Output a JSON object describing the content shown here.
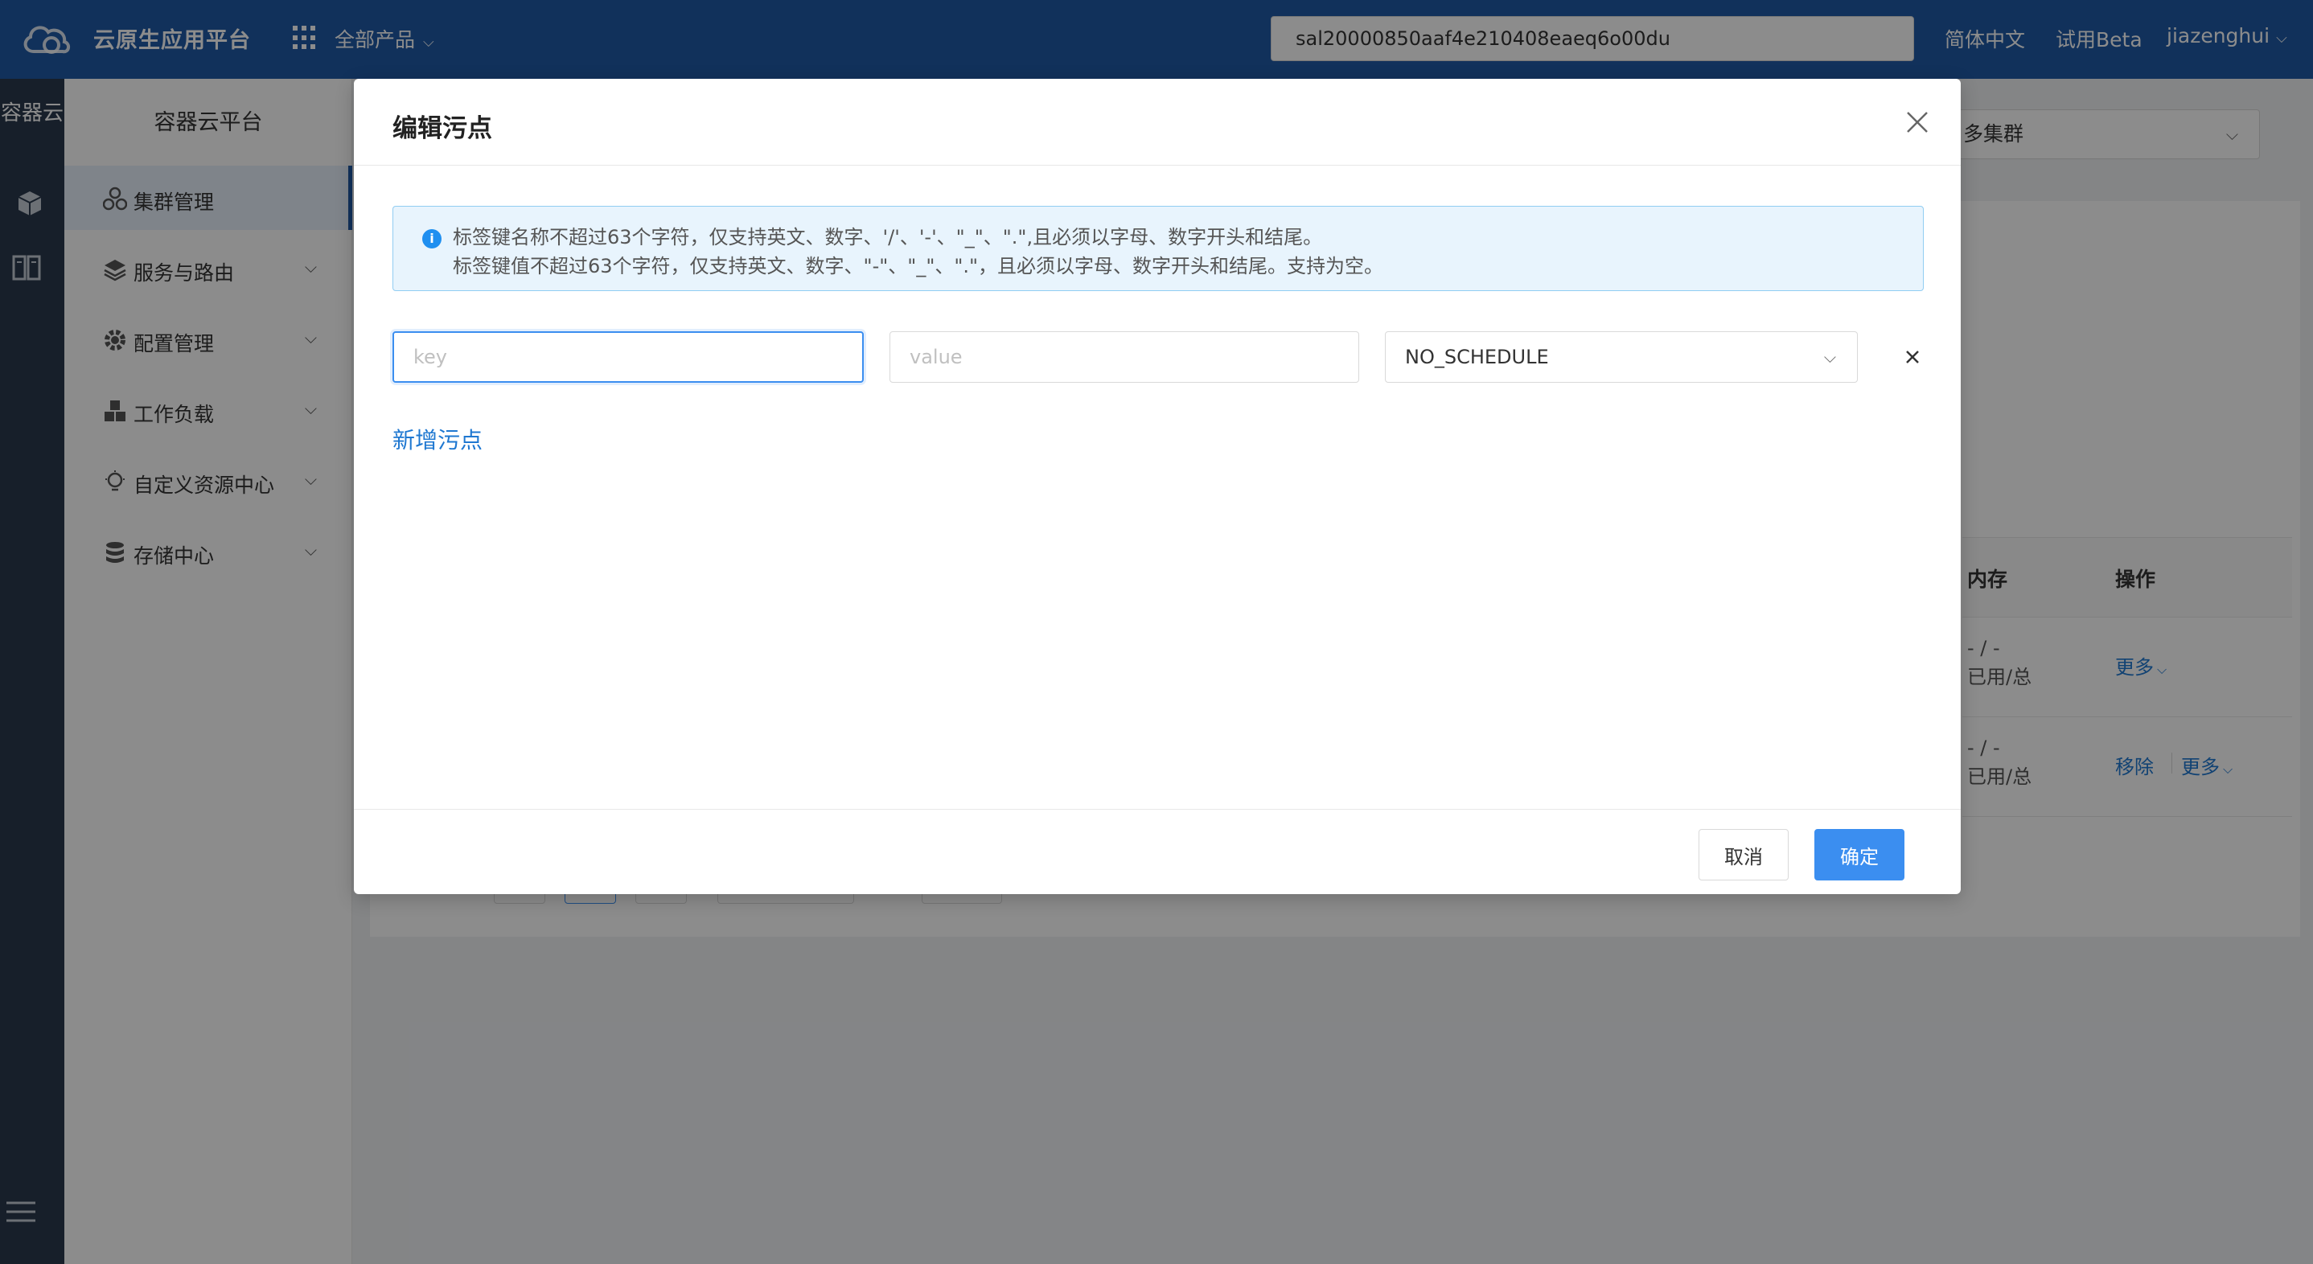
{
  "topbar": {
    "app_title": "云原生应用平台",
    "all_products": "全部产品",
    "search_value": "sal20000850aaf4e210408eaeq6o00du",
    "lang": "简体中文",
    "beta": "试用Beta",
    "user": "jiazenghui"
  },
  "rail": {
    "label": "容器云"
  },
  "sidebar": {
    "title": "容器云平台",
    "items": [
      {
        "label": "集群管理"
      },
      {
        "label": "服务与路由"
      },
      {
        "label": "配置管理"
      },
      {
        "label": "工作负载"
      },
      {
        "label": "自定义资源中心"
      },
      {
        "label": "存储中心"
      }
    ]
  },
  "background": {
    "cluster_select": "多集群",
    "table": {
      "col_memory": "内存",
      "col_ops": "操作",
      "rows": [
        {
          "mem_value": "- / -",
          "mem_unit": "已用/总",
          "op_more": "更多"
        },
        {
          "mem_value": "- / -",
          "mem_unit": "已用/总",
          "op_remove": "移除",
          "op_more": "更多"
        }
      ]
    }
  },
  "modal": {
    "title": "编辑污点",
    "alert": {
      "line1": "标签键名称不超过63个字符，仅支持英文、数字、'/'、'-'、\"_\"、\".\",且必须以字母、数字开头和结尾。",
      "line2": "标签键值不超过63个字符，仅支持英文、数字、\"-\"、\"_\"、\".\"，且必须以字母、数字开头和结尾。支持为空。"
    },
    "taint": {
      "key_placeholder": "key",
      "value_placeholder": "value",
      "effect": "NO_SCHEDULE"
    },
    "add_label": "新增污点",
    "cancel_label": "取消",
    "ok_label": "确定"
  },
  "colors": {
    "topbar": "#1f5aa6",
    "primary": "#3b8ef0",
    "link": "#1f78d1",
    "rail": "#2b3a4e"
  }
}
